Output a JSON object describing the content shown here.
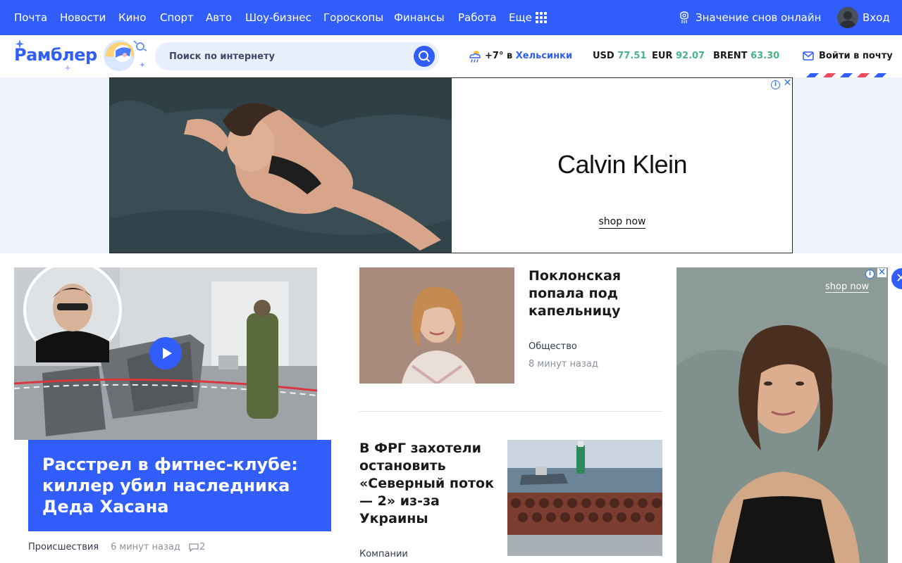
{
  "topnav": {
    "items": [
      "Почта",
      "Новости",
      "Кино",
      "Спорт",
      "Авто",
      "Шоу-бизнес",
      "Гороскопы",
      "Финансы",
      "Работа",
      "Еще"
    ],
    "dreams": "Значение снов онлайн",
    "login": "Вход"
  },
  "header": {
    "logo": "Рамблер",
    "search_placeholder": "Поиск по интернету",
    "weather": {
      "temp": "+7°",
      "in": "в",
      "city": "Хельсинки"
    },
    "rates": [
      {
        "name": "USD",
        "value": "77.51"
      },
      {
        "name": "EUR",
        "value": "92.07"
      },
      {
        "name": "BRENT",
        "value": "63.30"
      }
    ],
    "mail_login": "Войти в почту"
  },
  "banner": {
    "brand": "Calvin Klein",
    "cta": "shop now"
  },
  "side_ad": {
    "cta": "shop now"
  },
  "main_story": {
    "title": "Расстрел в фитнес-клубе: киллер убил наследника Деда Хасана",
    "category": "Происшествия",
    "time": "6 минут назад",
    "comments": "2"
  },
  "stories": [
    {
      "title": "Поклонская попала под капельницу",
      "category": "Общество",
      "time": "8 минут назад"
    },
    {
      "title": "В ФРГ захотели остановить «Северный поток — 2» из-за Украины",
      "category": "Компании"
    }
  ],
  "colors": {
    "brand": "#315efb",
    "rate_value": "#4ab487",
    "search_bg": "#e8effd"
  }
}
